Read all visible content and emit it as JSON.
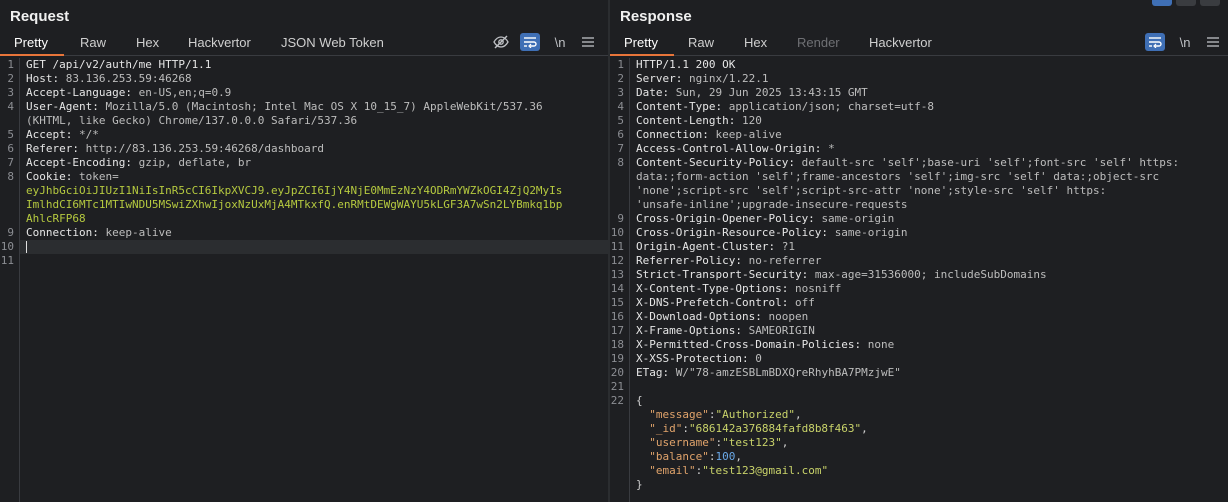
{
  "request": {
    "title": "Request",
    "tabs": [
      "Pretty",
      "Raw",
      "Hex",
      "Hackvertor",
      "JSON Web Token"
    ],
    "active_tab": "Pretty",
    "newline_toggle": "\\n",
    "lines": [
      {
        "n": "1",
        "segs": [
          {
            "t": "GET /api/v2/auth/me HTTP/1.1",
            "c": "k"
          }
        ]
      },
      {
        "n": "2",
        "segs": [
          {
            "t": "Host: ",
            "c": "k"
          },
          {
            "t": "83.136.253.59:46268",
            "c": "v"
          }
        ]
      },
      {
        "n": "3",
        "segs": [
          {
            "t": "Accept-Language: ",
            "c": "k"
          },
          {
            "t": "en-US,en;q=0.9",
            "c": "v"
          }
        ]
      },
      {
        "n": "4",
        "segs": [
          {
            "t": "User-Agent: ",
            "c": "k"
          },
          {
            "t": "Mozilla/5.0 (Macintosh; Intel Mac OS X 10_15_7) AppleWebKit/537.36",
            "c": "v"
          }
        ]
      },
      {
        "n": "",
        "segs": [
          {
            "t": "(KHTML, like Gecko) Chrome/137.0.0.0 Safari/537.36",
            "c": "v"
          }
        ]
      },
      {
        "n": "5",
        "segs": [
          {
            "t": "Accept: ",
            "c": "k"
          },
          {
            "t": "*/*",
            "c": "v"
          }
        ]
      },
      {
        "n": "6",
        "segs": [
          {
            "t": "Referer: ",
            "c": "k"
          },
          {
            "t": "http://83.136.253.59:46268/dashboard",
            "c": "v"
          }
        ]
      },
      {
        "n": "7",
        "segs": [
          {
            "t": "Accept-Encoding: ",
            "c": "k"
          },
          {
            "t": "gzip, deflate, br",
            "c": "v"
          }
        ]
      },
      {
        "n": "8",
        "segs": [
          {
            "t": "Cookie: ",
            "c": "k"
          },
          {
            "t": "token=",
            "c": "v"
          }
        ]
      },
      {
        "n": "",
        "segs": [
          {
            "t": "eyJhbGciOiJIUzI1NiIsInR5cCI6IkpXVCJ9.eyJpZCI6IjY4NjE0MmEzNzY4ODRmYWZkOGI4ZjQ2MyIs",
            "c": "hlv"
          }
        ]
      },
      {
        "n": "",
        "segs": [
          {
            "t": "ImlhdCI6MTc1MTIwNDU5MSwiZXhwIjoxNzUxMjA4MTkxfQ.enRMtDEWgWAYU5kLGF3A7wSn2LYBmkq1bp",
            "c": "hlv"
          }
        ]
      },
      {
        "n": "",
        "segs": [
          {
            "t": "AhlcRFP68",
            "c": "hlv"
          }
        ]
      },
      {
        "n": "9",
        "segs": [
          {
            "t": "Connection: ",
            "c": "k"
          },
          {
            "t": "keep-alive",
            "c": "v"
          }
        ]
      },
      {
        "n": "10",
        "segs": [],
        "cursor": true
      },
      {
        "n": "11",
        "segs": []
      }
    ]
  },
  "response": {
    "title": "Response",
    "tabs": [
      "Pretty",
      "Raw",
      "Hex",
      "Render",
      "Hackvertor"
    ],
    "active_tab": "Pretty",
    "newline_toggle": "\\n",
    "lines": [
      {
        "n": "1",
        "segs": [
          {
            "t": "HTTP/1.1 200 OK",
            "c": "k"
          }
        ]
      },
      {
        "n": "2",
        "segs": [
          {
            "t": "Server: ",
            "c": "k"
          },
          {
            "t": "nginx/1.22.1",
            "c": "v"
          }
        ]
      },
      {
        "n": "3",
        "segs": [
          {
            "t": "Date: ",
            "c": "k"
          },
          {
            "t": "Sun, 29 Jun 2025 13:43:15 GMT",
            "c": "v"
          }
        ]
      },
      {
        "n": "4",
        "segs": [
          {
            "t": "Content-Type: ",
            "c": "k"
          },
          {
            "t": "application/json; charset=utf-8",
            "c": "v"
          }
        ]
      },
      {
        "n": "5",
        "segs": [
          {
            "t": "Content-Length: ",
            "c": "k"
          },
          {
            "t": "120",
            "c": "v"
          }
        ]
      },
      {
        "n": "6",
        "segs": [
          {
            "t": "Connection: ",
            "c": "k"
          },
          {
            "t": "keep-alive",
            "c": "v"
          }
        ]
      },
      {
        "n": "7",
        "segs": [
          {
            "t": "Access-Control-Allow-Origin: ",
            "c": "k"
          },
          {
            "t": "*",
            "c": "v"
          }
        ]
      },
      {
        "n": "8",
        "segs": [
          {
            "t": "Content-Security-Policy: ",
            "c": "k"
          },
          {
            "t": "default-src 'self';base-uri 'self';font-src 'self' https:",
            "c": "v"
          }
        ]
      },
      {
        "n": "",
        "segs": [
          {
            "t": "data:;form-action 'self';frame-ancestors 'self';img-src 'self' data:;object-src",
            "c": "v"
          }
        ]
      },
      {
        "n": "",
        "segs": [
          {
            "t": "'none';script-src 'self';script-src-attr 'none';style-src 'self' https:",
            "c": "v"
          }
        ]
      },
      {
        "n": "",
        "segs": [
          {
            "t": "'unsafe-inline';upgrade-insecure-requests",
            "c": "v"
          }
        ]
      },
      {
        "n": "9",
        "segs": [
          {
            "t": "Cross-Origin-Opener-Policy: ",
            "c": "k"
          },
          {
            "t": "same-origin",
            "c": "v"
          }
        ]
      },
      {
        "n": "10",
        "segs": [
          {
            "t": "Cross-Origin-Resource-Policy: ",
            "c": "k"
          },
          {
            "t": "same-origin",
            "c": "v"
          }
        ]
      },
      {
        "n": "11",
        "segs": [
          {
            "t": "Origin-Agent-Cluster: ",
            "c": "k"
          },
          {
            "t": "?1",
            "c": "v"
          }
        ]
      },
      {
        "n": "12",
        "segs": [
          {
            "t": "Referrer-Policy: ",
            "c": "k"
          },
          {
            "t": "no-referrer",
            "c": "v"
          }
        ]
      },
      {
        "n": "13",
        "segs": [
          {
            "t": "Strict-Transport-Security: ",
            "c": "k"
          },
          {
            "t": "max-age=31536000; includeSubDomains",
            "c": "v"
          }
        ]
      },
      {
        "n": "14",
        "segs": [
          {
            "t": "X-Content-Type-Options: ",
            "c": "k"
          },
          {
            "t": "nosniff",
            "c": "v"
          }
        ]
      },
      {
        "n": "15",
        "segs": [
          {
            "t": "X-DNS-Prefetch-Control: ",
            "c": "k"
          },
          {
            "t": "off",
            "c": "v"
          }
        ]
      },
      {
        "n": "16",
        "segs": [
          {
            "t": "X-Download-Options: ",
            "c": "k"
          },
          {
            "t": "noopen",
            "c": "v"
          }
        ]
      },
      {
        "n": "17",
        "segs": [
          {
            "t": "X-Frame-Options: ",
            "c": "k"
          },
          {
            "t": "SAMEORIGIN",
            "c": "v"
          }
        ]
      },
      {
        "n": "18",
        "segs": [
          {
            "t": "X-Permitted-Cross-Domain-Policies: ",
            "c": "k"
          },
          {
            "t": "none",
            "c": "v"
          }
        ]
      },
      {
        "n": "19",
        "segs": [
          {
            "t": "X-XSS-Protection: ",
            "c": "k"
          },
          {
            "t": "0",
            "c": "v"
          }
        ]
      },
      {
        "n": "20",
        "segs": [
          {
            "t": "ETag: ",
            "c": "k"
          },
          {
            "t": "W/\"78-amzESBLmBDXQreRhyhBA7PMzjwE\"",
            "c": "v"
          }
        ]
      },
      {
        "n": "21",
        "segs": []
      },
      {
        "n": "22",
        "segs": [
          {
            "t": "{",
            "c": "jp"
          }
        ]
      },
      {
        "n": "",
        "segs": [
          {
            "t": "  \"message\"",
            "c": "jk"
          },
          {
            "t": ":",
            "c": "jp"
          },
          {
            "t": "\"Authorized\"",
            "c": "js"
          },
          {
            "t": ",",
            "c": "jp"
          }
        ]
      },
      {
        "n": "",
        "segs": [
          {
            "t": "  \"_id\"",
            "c": "jk"
          },
          {
            "t": ":",
            "c": "jp"
          },
          {
            "t": "\"686142a376884fafd8b8f463\"",
            "c": "js"
          },
          {
            "t": ",",
            "c": "jp"
          }
        ]
      },
      {
        "n": "",
        "segs": [
          {
            "t": "  \"username\"",
            "c": "jk"
          },
          {
            "t": ":",
            "c": "jp"
          },
          {
            "t": "\"test123\"",
            "c": "js"
          },
          {
            "t": ",",
            "c": "jp"
          }
        ]
      },
      {
        "n": "",
        "segs": [
          {
            "t": "  \"balance\"",
            "c": "jk"
          },
          {
            "t": ":",
            "c": "jp"
          },
          {
            "t": "100",
            "c": "jn"
          },
          {
            "t": ",",
            "c": "jp"
          }
        ]
      },
      {
        "n": "",
        "segs": [
          {
            "t": "  \"email\"",
            "c": "jk"
          },
          {
            "t": ":",
            "c": "jp"
          },
          {
            "t": "\"test123@gmail.com\"",
            "c": "js"
          }
        ]
      },
      {
        "n": "",
        "segs": [
          {
            "t": "}",
            "c": "jp"
          }
        ],
        "cursor_line": true
      }
    ]
  },
  "colors": {
    "background": "#1e1f22",
    "accent_tab": "#e8753a",
    "toggle_active": "#3f6fb5",
    "header_value_highlight": "#b5c93f",
    "json_key": "#e0a36b",
    "json_string": "#c9d36a",
    "json_number": "#6aa9e8"
  },
  "icons": {
    "hide_icon": "eye-slash-icon",
    "wrap_icon": "word-wrap-icon",
    "menu_icon": "hamburger-menu-icon"
  }
}
